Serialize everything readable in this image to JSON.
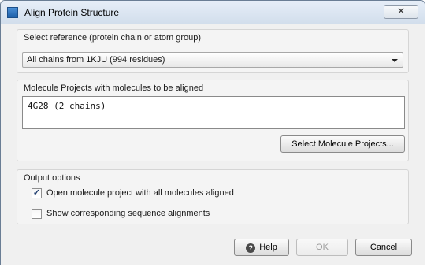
{
  "window": {
    "title": "Align Protein Structure",
    "close_glyph": "✕"
  },
  "reference": {
    "label": "Select reference (protein chain or atom group)",
    "selected": "All chains from 1KJU (994 residues)"
  },
  "molecules": {
    "label": "Molecule Projects with molecules to be aligned",
    "items": [
      "4G28 (2 chains)"
    ],
    "select_button": "Select Molecule Projects..."
  },
  "output": {
    "label": "Output options",
    "options": [
      {
        "label": "Open molecule project with all molecules aligned",
        "checked": true
      },
      {
        "label": "Show corresponding sequence alignments",
        "checked": false
      }
    ]
  },
  "footer": {
    "help": "Help",
    "help_glyph": "?",
    "ok": "OK",
    "cancel": "Cancel"
  }
}
